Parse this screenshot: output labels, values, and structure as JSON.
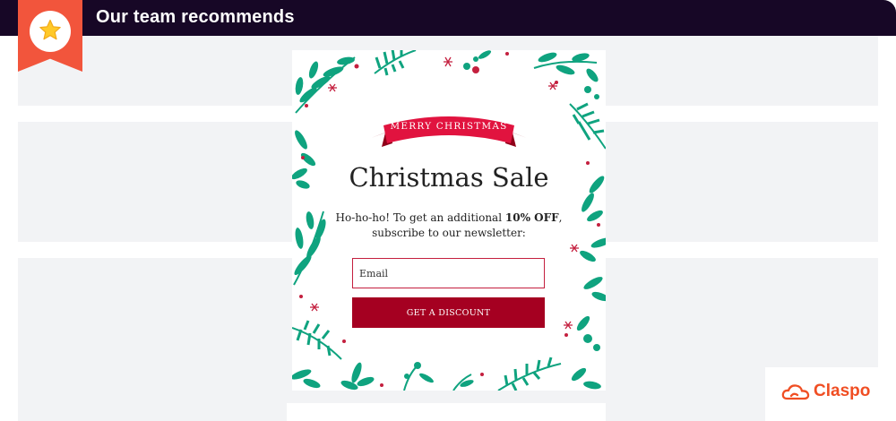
{
  "header": {
    "title": "Our team recommends",
    "badge_icon": "star-icon"
  },
  "popup": {
    "ribbon_text": "MERRY CHRISTMAS",
    "headline": "Christmas Sale",
    "subtext_before": "Ho-ho-ho! To get an additional ",
    "subtext_bold": "10% OFF",
    "subtext_after": ", subscribe to our newsletter:",
    "email_placeholder": "Email",
    "button_label": "GET A DISCOUNT",
    "colors": {
      "accent": "#a50021",
      "leaf": "#0fa37f",
      "berry": "#c41f3e"
    }
  },
  "brand": {
    "name": "Claspo",
    "color": "#f04e23"
  },
  "colors": {
    "topbar": "#170726",
    "ribbon": "#f2553c",
    "placeholder_block": "#f2f3f5"
  }
}
